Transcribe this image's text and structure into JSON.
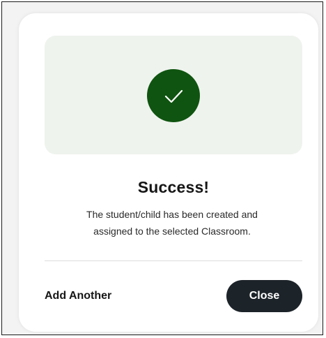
{
  "dialog": {
    "icon": "check-icon",
    "accent_color": "#0f5410",
    "hero_background": "#eff3ee",
    "title": "Success!",
    "message_line1": "The student/child has been created and",
    "message_line2": "assigned to the selected Classroom."
  },
  "actions": {
    "add_another_label": "Add Another",
    "close_label": "Close",
    "close_button_color": "#1c2329"
  }
}
